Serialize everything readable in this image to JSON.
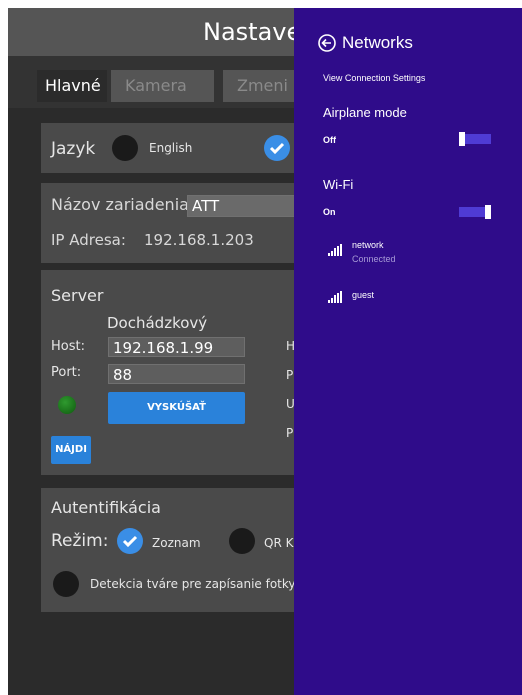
{
  "app": {
    "title": "Nastave",
    "tabs": [
      {
        "label": "Hlavné",
        "active": true
      },
      {
        "label": "Kamera",
        "active": false
      },
      {
        "label": "Zmeni",
        "active": false
      }
    ],
    "language": {
      "label": "Jazyk",
      "option_label": "English",
      "selected_checked": true
    },
    "device": {
      "name_label": "Názov zariadenia",
      "name_value": "ATT",
      "ip_label": "IP Adresa:",
      "ip_value": "192.168.1.203"
    },
    "server": {
      "title": "Server",
      "subtitle": "Dochádzkový",
      "host_label": "Host:",
      "host_value": "192.168.1.99",
      "port_label": "Port:",
      "port_value": "88",
      "test_button": "VYSKÚŠAŤ",
      "find_button": "NÁJDI",
      "right_labels": [
        "H",
        "P",
        "U",
        "P"
      ]
    },
    "auth": {
      "title": "Autentifikácia",
      "mode_label": "Režim:",
      "option_list": "Zoznam",
      "option_qr": "QR K",
      "face_detect": "Detekcia tváre pre zapísanie fotky"
    }
  },
  "charms": {
    "title": "Networks",
    "view_settings": "View Connection Settings",
    "airplane_label": "Airplane mode",
    "airplane_state": "Off",
    "wifi_label": "Wi-Fi",
    "wifi_state": "On",
    "networks": [
      {
        "name": "network",
        "status": "Connected"
      },
      {
        "name": "guest",
        "status": ""
      }
    ],
    "colors": {
      "background": "#2f0c8a",
      "toggle": "#4f3bd4"
    }
  }
}
